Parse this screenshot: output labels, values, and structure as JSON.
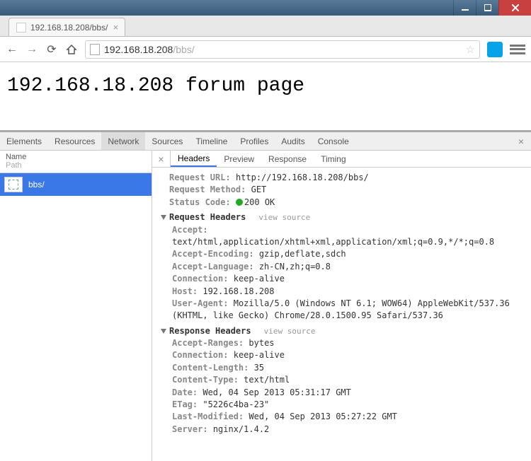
{
  "tab": {
    "title": "192.168.18.208/bbs/"
  },
  "address": {
    "host": "192.168.18.208",
    "path": "/bbs/"
  },
  "page": {
    "heading": "192.168.18.208 forum page"
  },
  "devtabs": {
    "elements": "Elements",
    "resources": "Resources",
    "network": "Network",
    "sources": "Sources",
    "timeline": "Timeline",
    "profiles": "Profiles",
    "audits": "Audits",
    "console": "Console"
  },
  "leftpanel": {
    "name": "Name",
    "path": "Path",
    "rows": [
      {
        "label": "bbs/"
      }
    ]
  },
  "rtabs": {
    "headers": "Headers",
    "preview": "Preview",
    "response": "Response",
    "timing": "Timing"
  },
  "general": {
    "request_url_k": "Request URL:",
    "request_url_v": "http://192.168.18.208/bbs/",
    "request_method_k": "Request Method:",
    "request_method_v": "GET",
    "status_code_k": "Status Code:",
    "status_code_v": "200 OK"
  },
  "request_headers": {
    "title": "Request Headers",
    "view_source": "view source",
    "accept_k": "Accept:",
    "accept_v": "text/html,application/xhtml+xml,application/xml;q=0.9,*/*;q=0.8",
    "accept_encoding_k": "Accept-Encoding:",
    "accept_encoding_v": "gzip,deflate,sdch",
    "accept_language_k": "Accept-Language:",
    "accept_language_v": "zh-CN,zh;q=0.8",
    "connection_k": "Connection:",
    "connection_v": "keep-alive",
    "host_k": "Host:",
    "host_v": "192.168.18.208",
    "user_agent_k": "User-Agent:",
    "user_agent_v": "Mozilla/5.0 (Windows NT 6.1; WOW64) AppleWebKit/537.36 (KHTML, like Gecko) Chrome/28.0.1500.95 Safari/537.36"
  },
  "response_headers": {
    "title": "Response Headers",
    "view_source": "view source",
    "accept_ranges_k": "Accept-Ranges:",
    "accept_ranges_v": "bytes",
    "connection_k": "Connection:",
    "connection_v": "keep-alive",
    "content_length_k": "Content-Length:",
    "content_length_v": "35",
    "content_type_k": "Content-Type:",
    "content_type_v": "text/html",
    "date_k": "Date:",
    "date_v": "Wed, 04 Sep 2013 05:31:17 GMT",
    "etag_k": "ETag:",
    "etag_v": "\"5226c4ba-23\"",
    "last_modified_k": "Last-Modified:",
    "last_modified_v": "Wed, 04 Sep 2013 05:27:22 GMT",
    "server_k": "Server:",
    "server_v": "nginx/1.4.2"
  }
}
